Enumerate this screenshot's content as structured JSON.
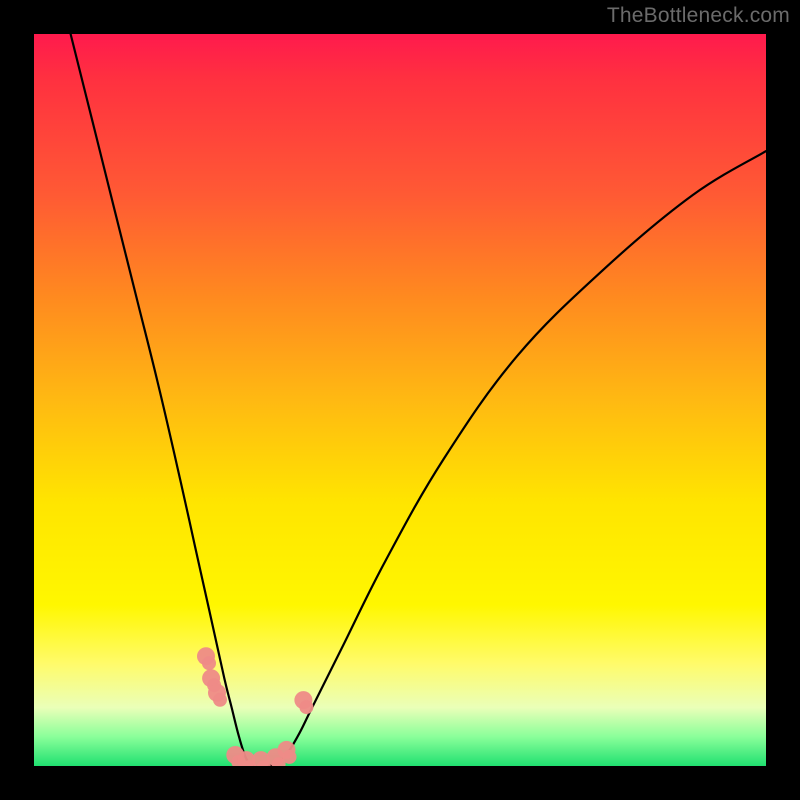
{
  "watermark": "TheBottleneck.com",
  "colors": {
    "frame": "#000000",
    "curve_stroke": "#000000",
    "marker_fill": "#ee8b87",
    "gradient_stops": [
      "#ff1a4d",
      "#ff3040",
      "#ff5a34",
      "#ff8a1f",
      "#ffb912",
      "#ffe500",
      "#fff700",
      "#fffb6a",
      "#eaffb8",
      "#8aff9a",
      "#20e070"
    ]
  },
  "chart_data": {
    "type": "line",
    "title": "",
    "xlabel": "",
    "ylabel": "",
    "xlim": [
      0,
      100
    ],
    "ylim": [
      0,
      100
    ],
    "grid": false,
    "legend": false,
    "note": "Values are approximate, read from the unlabeled plot. y≈0 is the bottom (green), y≈100 is the top (red). The curve is a V-shaped bottleneck trough centered near x≈30.",
    "series": [
      {
        "name": "bottleneck-curve",
        "x": [
          5,
          8,
          11,
          14,
          17,
          20,
          22,
          24,
          26,
          27,
          28,
          29,
          30,
          32,
          34,
          36,
          38,
          42,
          48,
          56,
          66,
          78,
          90,
          100
        ],
        "y": [
          100,
          88,
          76,
          64,
          52,
          39,
          30,
          21,
          12,
          8,
          4,
          1,
          0,
          0,
          1,
          4,
          8,
          16,
          28,
          42,
          56,
          68,
          78,
          84
        ]
      }
    ],
    "markers": [
      {
        "name": "left-cluster-a",
        "x": 23.5,
        "y": 15
      },
      {
        "name": "left-cluster-b",
        "x": 24.2,
        "y": 12
      },
      {
        "name": "left-cluster-c",
        "x": 25.0,
        "y": 10
      },
      {
        "name": "trough-a",
        "x": 27.5,
        "y": 1.5
      },
      {
        "name": "trough-b",
        "x": 29.0,
        "y": 0.8
      },
      {
        "name": "trough-c",
        "x": 31.0,
        "y": 0.8
      },
      {
        "name": "trough-d",
        "x": 33.0,
        "y": 1.2
      },
      {
        "name": "trough-e",
        "x": 34.5,
        "y": 2.2
      },
      {
        "name": "right-point",
        "x": 36.8,
        "y": 9
      }
    ]
  }
}
